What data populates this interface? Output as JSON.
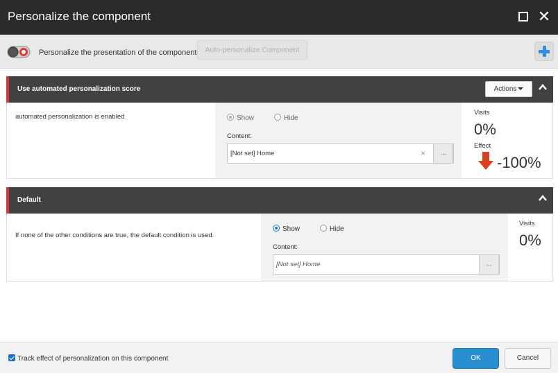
{
  "window": {
    "title": "Personalize the component",
    "maximize_icon": "maximize-icon",
    "close_icon": "close-icon"
  },
  "toolbar": {
    "label": "Personalize the presentation of the component",
    "auto_button": "Auto-personalize Component",
    "add_icon": "plus-icon",
    "toggle_icon": "personalization-toggle-icon"
  },
  "rules": [
    {
      "title": "Use automated personalization score",
      "actions_label": "Actions",
      "condition": "automated personalization is enabled",
      "show_label": "Show",
      "hide_label": "Hide",
      "selected": "Show",
      "content_label": "Content:",
      "content_value": "[Not set] Home",
      "clear_symbol": "×",
      "browse_label": "...",
      "visits_label": "Visits",
      "visits_value": "0%",
      "effect_label": "Effect",
      "effect_value": "-100%",
      "effect_icon": "down-arrow-icon",
      "effect_color": "#d9411e"
    },
    {
      "title": "Default",
      "condition": "If none of the other conditions are true, the default condition is used.",
      "show_label": "Show",
      "hide_label": "Hide",
      "selected": "Show",
      "content_label": "Content:",
      "content_value": "[Not set] Home",
      "browse_label": "...",
      "visits_label": "Visits",
      "visits_value": "0%"
    }
  ],
  "footer": {
    "track_label": "Track effect of personalization on this component",
    "track_checked": true,
    "ok_label": "OK",
    "cancel_label": "Cancel"
  },
  "colors": {
    "accent": "#d9352c",
    "primary_button": "#2a8fd0",
    "titlebar": "#2b2b2b"
  }
}
